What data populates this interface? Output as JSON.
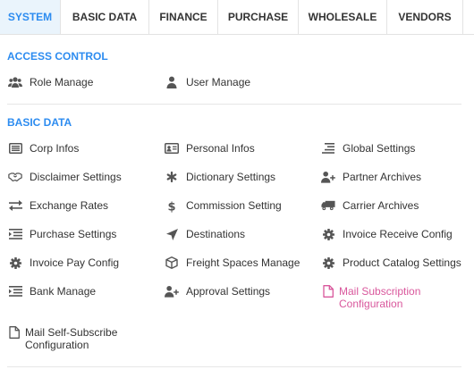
{
  "tabs": [
    {
      "label": "SYSTEM",
      "active": true
    },
    {
      "label": "BASIC DATA"
    },
    {
      "label": "FINANCE"
    },
    {
      "label": "PURCHASE"
    },
    {
      "label": "WHOLESALE"
    },
    {
      "label": "VENDORS"
    }
  ],
  "access_control": {
    "title": "ACCESS CONTROL",
    "items": [
      {
        "label": "Role Manage",
        "icon": "users-icon"
      },
      {
        "label": "User Manage",
        "icon": "user-icon"
      }
    ]
  },
  "basic_data": {
    "title": "BASIC DATA",
    "items": [
      {
        "label": "Corp Infos",
        "icon": "list-box-icon"
      },
      {
        "label": "Personal Infos",
        "icon": "id-card-icon"
      },
      {
        "label": "Global Settings",
        "icon": "align-right-icon"
      },
      {
        "label": "Disclaimer Settings",
        "icon": "handshake-icon"
      },
      {
        "label": "Dictionary Settings",
        "icon": "asterisk-icon"
      },
      {
        "label": "Partner Archives",
        "icon": "user-plus-icon"
      },
      {
        "label": "Exchange Rates",
        "icon": "exchange-icon"
      },
      {
        "label": "Commission Setting",
        "icon": "dollar-icon"
      },
      {
        "label": "Carrier Archives",
        "icon": "truck-icon"
      },
      {
        "label": "Purchase Settings",
        "icon": "indent-icon"
      },
      {
        "label": "Destinations",
        "icon": "location-arrow-icon"
      },
      {
        "label": "Invoice Receive Config",
        "icon": "gear-icon"
      },
      {
        "label": "Invoice Pay Config",
        "icon": "gear-icon"
      },
      {
        "label": "Freight Spaces Manage",
        "icon": "cube-icon"
      },
      {
        "label": "Product Catalog Settings",
        "icon": "gear-icon"
      },
      {
        "label": "Bank Manage",
        "icon": "indent-icon"
      },
      {
        "label": "Approval Settings",
        "icon": "user-plus-icon"
      },
      {
        "label": "Mail Subscription Configuration",
        "icon": "file-icon"
      },
      {
        "label": "Mail Self-Subscribe Configuration",
        "icon": "file-icon"
      }
    ]
  },
  "colors": {
    "accent": "#2d8cf0",
    "link_pink": "#d9579c",
    "active_tab_bg": "#eaf4fc"
  }
}
